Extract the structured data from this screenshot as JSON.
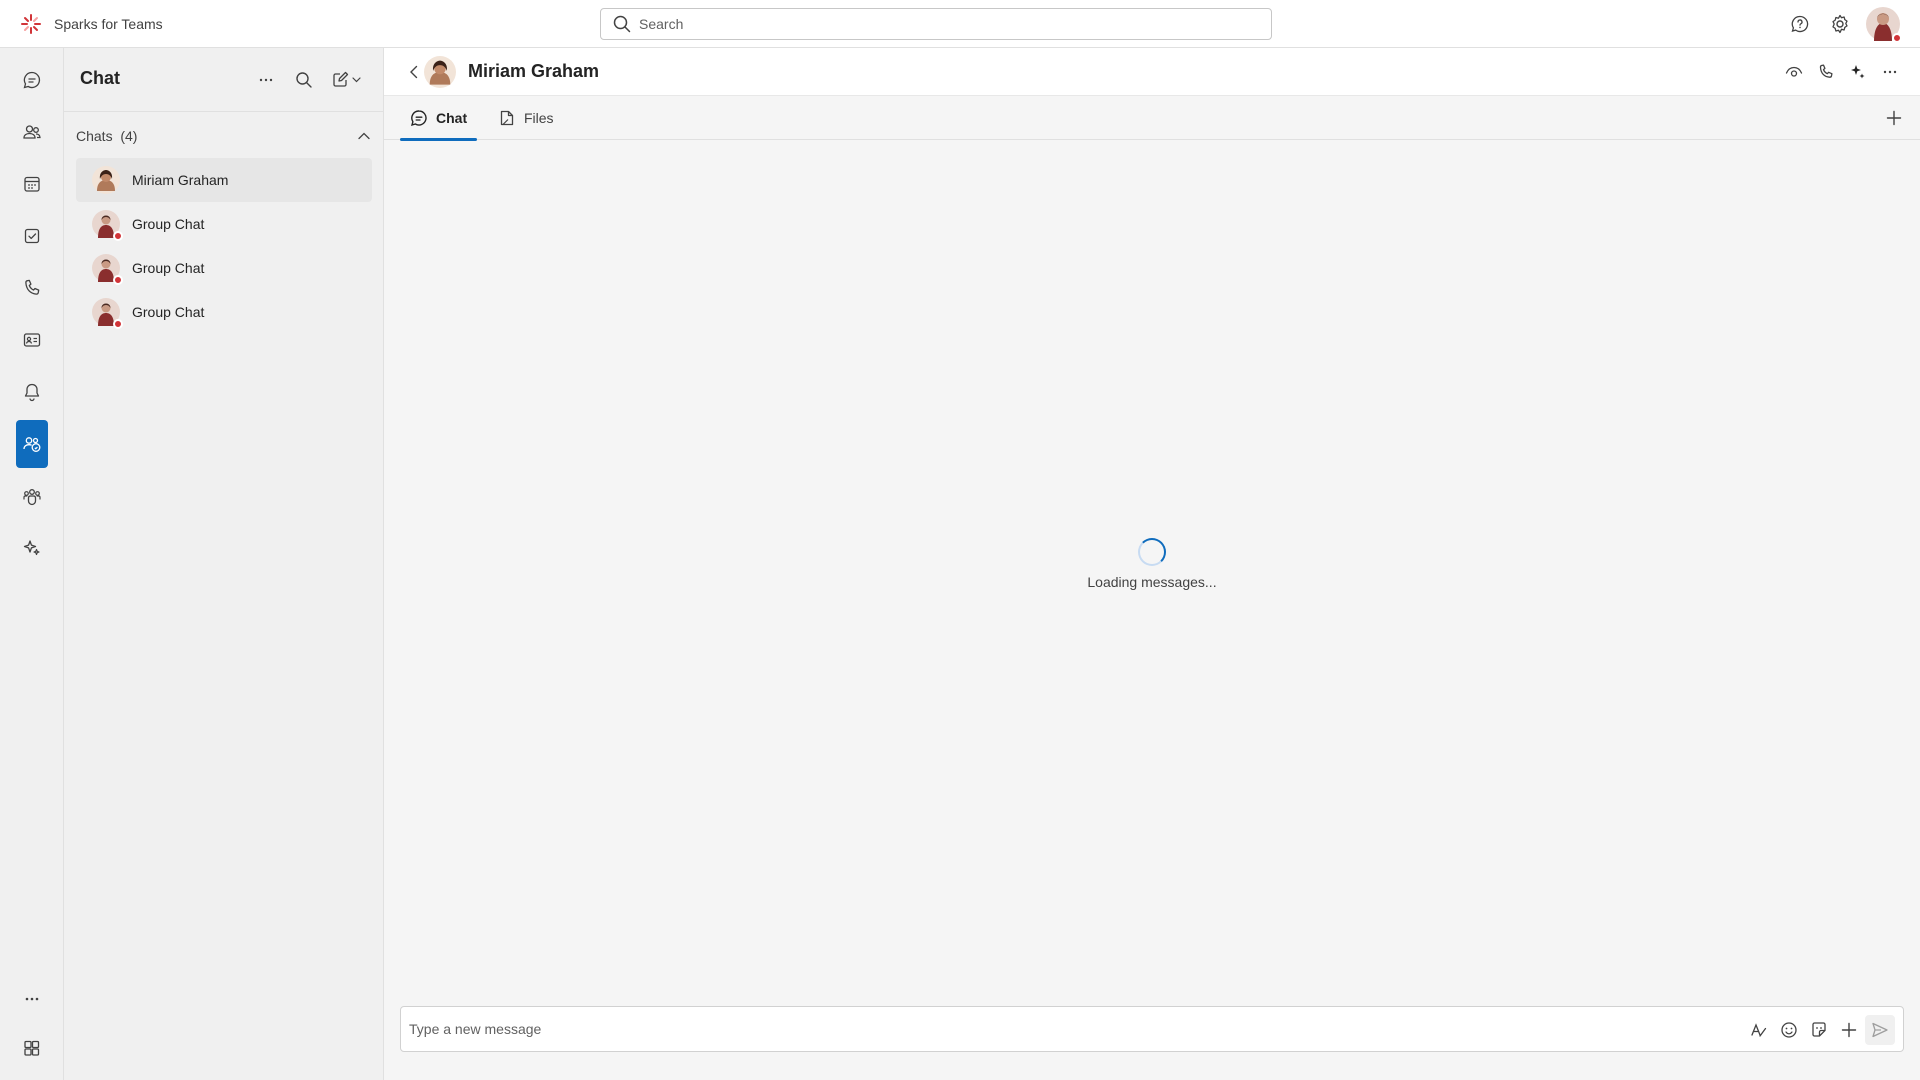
{
  "app": {
    "title": "Sparks for Teams",
    "accent": "#0f6cbd",
    "brand_icon": "sparks-logo-icon"
  },
  "search": {
    "placeholder": "Search",
    "value": ""
  },
  "top_right": {
    "icons": [
      "help-icon",
      "settings-icon",
      "user-avatar"
    ]
  },
  "rail": {
    "items": [
      {
        "icon": "chat-icon"
      },
      {
        "icon": "people-icon"
      },
      {
        "icon": "calendar-icon"
      },
      {
        "icon": "tasks-icon"
      },
      {
        "icon": "calls-icon"
      },
      {
        "icon": "contact-card-icon"
      },
      {
        "icon": "bell-icon"
      },
      {
        "icon": "people-chat-icon",
        "active": true
      },
      {
        "icon": "teams-icon"
      },
      {
        "icon": "sparkle-icon"
      },
      {
        "icon": "more-icon"
      },
      {
        "icon": "apps-icon"
      }
    ]
  },
  "chat_list": {
    "title": "Chat",
    "section_label": "Chats",
    "section_count": "(4)",
    "items": [
      {
        "name": "Miriam Graham",
        "selected": true
      },
      {
        "name": "Group Chat"
      },
      {
        "name": "Group Chat"
      },
      {
        "name": "Group Chat"
      }
    ]
  },
  "conversation": {
    "title": "Miriam Graham",
    "tabs": [
      {
        "label": "Chat",
        "active": true
      },
      {
        "label": "Files"
      }
    ],
    "loading_text": "Loading messages...",
    "composer_placeholder": "Type a new message"
  }
}
